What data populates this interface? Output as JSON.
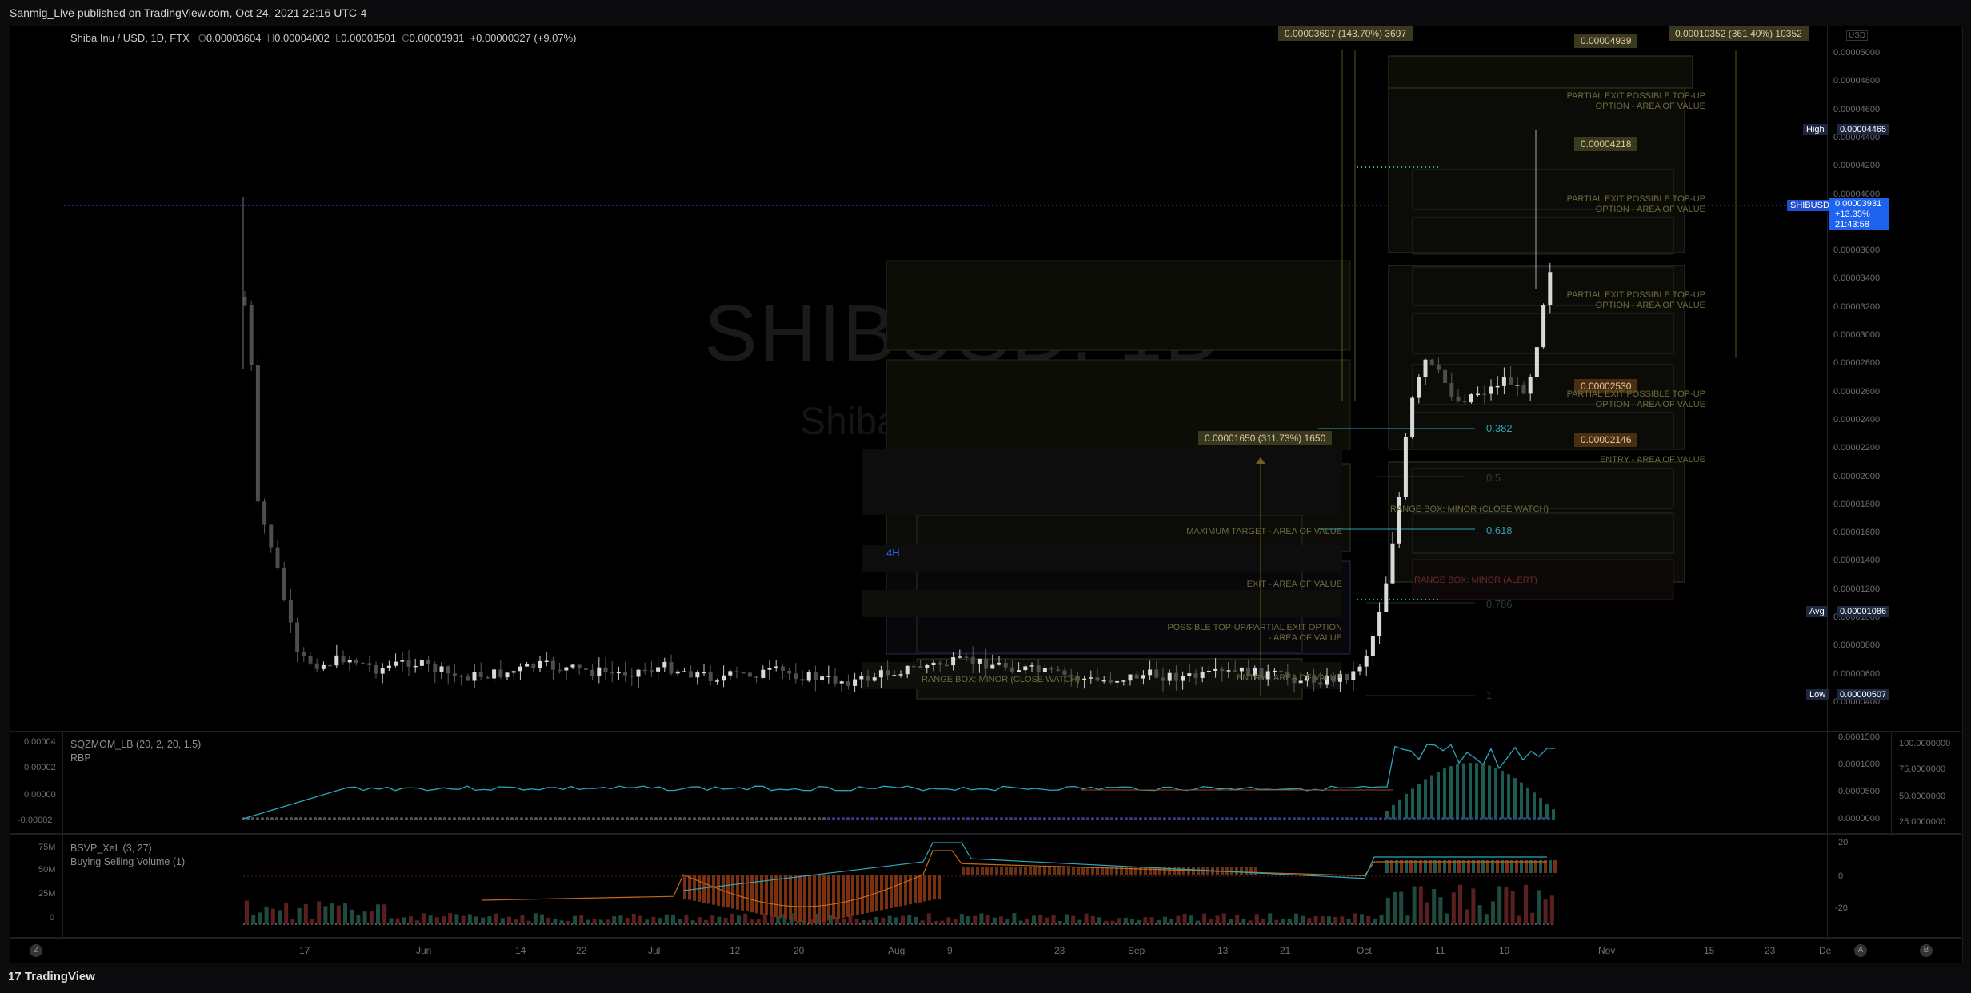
{
  "publish_line": "Sanmig_Live published on TradingView.com, Oct 24, 2021 22:16 UTC-4",
  "brand": "TradingView",
  "symbol_header": {
    "name": "Shiba Inu / USD, 1D, FTX",
    "o_label": "O",
    "o": "0.00003604",
    "h_label": "H",
    "h": "0.00004002",
    "l_label": "L",
    "l": "0.00003501",
    "c_label": "C",
    "c": "0.00003931",
    "change": "+0.00000327 (+9.07%)"
  },
  "watermark": {
    "symbol": "SHIBUSD, 1D",
    "name": "Shiba Inu / USD"
  },
  "price_axis": {
    "currency": "USD",
    "ticks": [
      "0.00005000",
      "0.00004800",
      "0.00004600",
      "0.00004400",
      "0.00004200",
      "0.00004000",
      "0.00003800",
      "0.00003600",
      "0.00003400",
      "0.00003200",
      "0.00003000",
      "0.00002800",
      "0.00002600",
      "0.00002400",
      "0.00002200",
      "0.00002000",
      "0.00001800",
      "0.00001600",
      "0.00001400",
      "0.00001200",
      "0.00001000",
      "0.00000800",
      "0.00000600",
      "0.00000400"
    ],
    "high_label": "High",
    "high": "0.00004465",
    "symbol_label": "SHIBUSD",
    "last": "0.00003931",
    "last_change": "+13.35%",
    "countdown": "21:43:58",
    "avg_label": "Avg",
    "avg": "0.00001086",
    "low_label": "Low",
    "low": "0.00000507"
  },
  "measure_tags": {
    "m1": "0.00003697 (143.70%) 3697",
    "m2": "0.00010352 (361.40%) 10352",
    "m3": "0.00001650 (311.73%) 1650"
  },
  "price_tags": {
    "t1": "0.00004939",
    "t2": "0.00004218",
    "t3": "0.00002530",
    "t4": "0.00002146"
  },
  "zone_labels": {
    "z1a": "PARTIAL EXIT  POSSIBLE TOP-UP",
    "z1b": "OPTION - AREA OF VALUE",
    "z2a": "PARTIAL EXIT  POSSIBLE TOP-UP",
    "z2b": "OPTION - AREA OF VALUE",
    "z3a": "PARTIAL EXIT  POSSIBLE TOP-UP",
    "z3b": "OPTION - AREA OF VALUE",
    "z4a": "PARTIAL EXIT  POSSIBLE TOP-UP",
    "z4b": "OPTION - AREA OF VALUE",
    "entry_right": "ENTRY - AREA OF VALUE",
    "range_minor_watch": "RANGE BOX: MINOR  (CLOSE WATCH)",
    "range_minor_alert": "RANGE BOX: MINOR (ALERT)",
    "max_target": "MAXIMUM TARGET - AREA OF VALUE",
    "exit": "EXIT - AREA OF VALUE",
    "topup_a": "POSSIBLE TOP-UP/PARTIAL EXIT OPTION",
    "topup_b": "- AREA OF VALUE",
    "range_minor_watch_left": "RANGE BOX: MINOR  (CLOSE WATCH)",
    "entry_left": "ENTRY - AREA OF VALUE",
    "tf_4h": "4H"
  },
  "fib": {
    "f382": "0.382",
    "f5": "0.5",
    "f618": "0.618",
    "f786": "0.786",
    "f1": "1"
  },
  "indicator1": {
    "title": "SQZMOM_LB (20, 2, 20, 1.5)",
    "subtitle": "RBP",
    "left_ticks": [
      "0.00004",
      "0.00002",
      "0.00000",
      "-0.00002"
    ],
    "right_ticks": [
      "0.0001500",
      "0.0001000",
      "0.0000500",
      "0.0000000"
    ],
    "far_right_ticks": [
      "100.0000000",
      "75.0000000",
      "50.0000000",
      "25.0000000"
    ]
  },
  "indicator2": {
    "title": "BSVP_XeL (3, 27)",
    "subtitle": "Buying Selling Volume (1)",
    "left_ticks": [
      "75M",
      "50M",
      "25M",
      "0"
    ],
    "right_ticks": [
      "20",
      "0",
      "-20"
    ]
  },
  "time_axis": [
    "17",
    "Jun",
    "14",
    "22",
    "Jul",
    "12",
    "20",
    "Aug",
    "9",
    "23",
    "Sep",
    "13",
    "21",
    "Oct",
    "11",
    "19",
    "Nov",
    "15",
    "23",
    "De"
  ],
  "corner_buttons": {
    "left": "Z",
    "mid": "A",
    "right": "B"
  },
  "colors": {
    "bull": "#e8e8e8",
    "bear": "#555555",
    "accent_blue": "#2962ff",
    "zone_olive": "#3a381f",
    "fib_teal": "#2fa0b5"
  }
}
